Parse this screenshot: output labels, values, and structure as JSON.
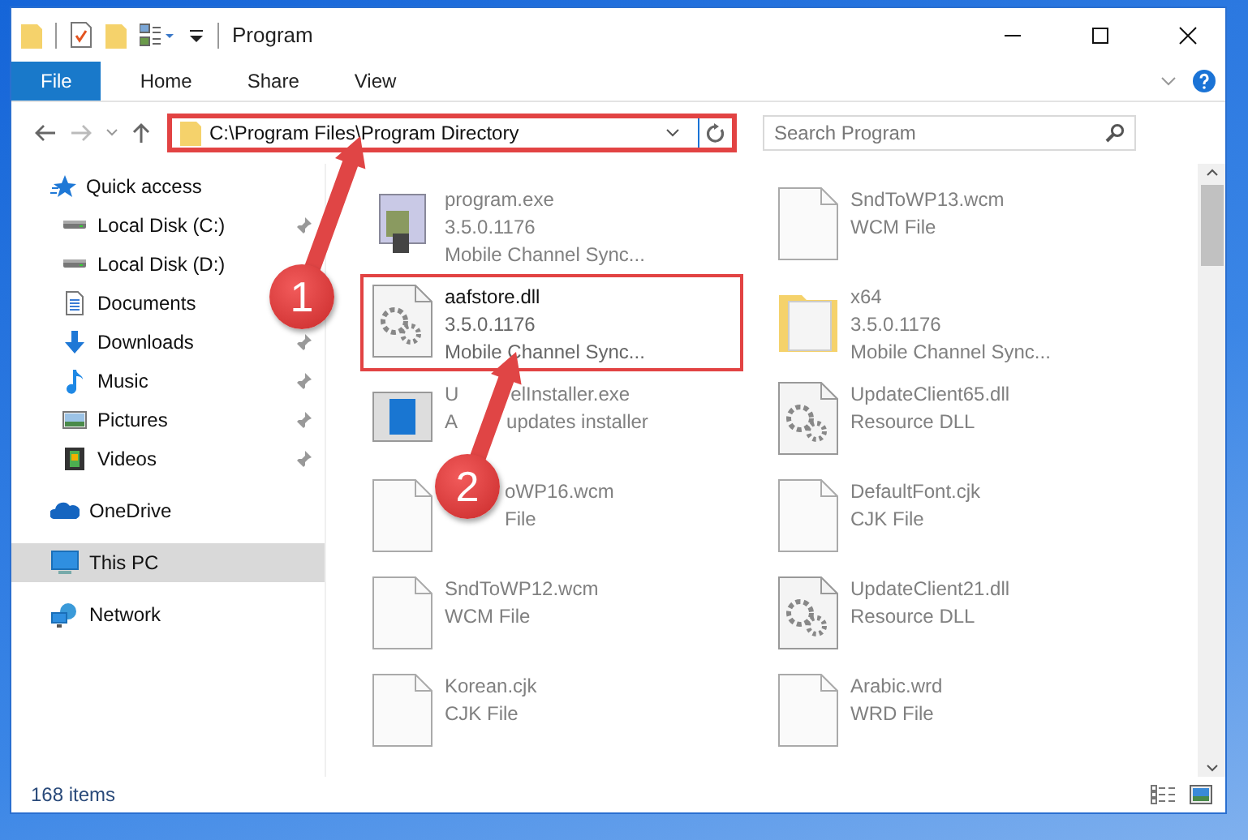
{
  "window": {
    "title": "Program"
  },
  "ribbon_tabs": [
    {
      "label": "File",
      "kind": "file"
    },
    {
      "label": "Home",
      "kind": "tab"
    },
    {
      "label": "Share",
      "kind": "tab"
    },
    {
      "label": "View",
      "kind": "tab"
    }
  ],
  "address": {
    "path": "C:\\Program Files\\Program Directory",
    "highlighted": true
  },
  "search": {
    "placeholder": "Search Program"
  },
  "sidebar": {
    "items": [
      {
        "label": "Quick access",
        "kind": "star",
        "pinned": false,
        "selected": false,
        "children": [
          {
            "label": "Local Disk (C:)",
            "kind": "drive",
            "pinned": true,
            "selected": false
          },
          {
            "label": "Local Disk (D:)",
            "kind": "drive",
            "pinned": false,
            "selected": false
          },
          {
            "label": "Documents",
            "kind": "document",
            "pinned": false,
            "selected": false
          },
          {
            "label": "Downloads",
            "kind": "download",
            "pinned": true,
            "selected": false
          },
          {
            "label": "Music",
            "kind": "music",
            "pinned": true,
            "selected": false
          },
          {
            "label": "Pictures",
            "kind": "pictures",
            "pinned": true,
            "selected": false
          },
          {
            "label": "Videos",
            "kind": "videos",
            "pinned": true,
            "selected": false
          }
        ]
      },
      {
        "label": "OneDrive",
        "kind": "cloud",
        "pinned": false,
        "selected": false
      },
      {
        "label": "This PC",
        "kind": "pc",
        "pinned": false,
        "selected": true
      },
      {
        "label": "Network",
        "kind": "network",
        "pinned": false,
        "selected": false
      }
    ]
  },
  "files": [
    {
      "name": "program.exe",
      "details": [
        "3.5.0.1176",
        "Mobile Channel Sync..."
      ],
      "kind": "exe",
      "highlighted": false
    },
    {
      "name": "SndToWP13.wcm",
      "details": [
        "WCM File"
      ],
      "kind": "blank",
      "highlighted": false
    },
    {
      "name": "aafstore.dll",
      "details": [
        "3.5.0.1176",
        "Mobile Channel Sync..."
      ],
      "kind": "gears",
      "highlighted": true
    },
    {
      "name": "x64",
      "details": [
        "3.5.0.1176",
        "Mobile Channel Sync..."
      ],
      "kind": "folder",
      "highlighted": false
    },
    {
      "name_parts": [
        "U",
        "elInstaller.exe"
      ],
      "detail_parts": [
        [
          "A",
          "updates installer"
        ]
      ],
      "kind": "installer",
      "highlighted": false,
      "covered": true
    },
    {
      "name": "UpdateClient65.dll",
      "details": [
        "Resource DLL"
      ],
      "kind": "gears",
      "highlighted": false
    },
    {
      "name": "oWP16.wcm",
      "details": [
        "File"
      ],
      "kind": "blank",
      "highlighted": false,
      "covered": true
    },
    {
      "name": "DefaultFont.cjk",
      "details": [
        "CJK File"
      ],
      "kind": "blank",
      "highlighted": false
    },
    {
      "name": "SndToWP12.wcm",
      "details": [
        "WCM File"
      ],
      "kind": "blank",
      "highlighted": false
    },
    {
      "name": "UpdateClient21.dll",
      "details": [
        "Resource DLL"
      ],
      "kind": "gears",
      "highlighted": false
    },
    {
      "name": "Korean.cjk",
      "details": [
        "CJK File"
      ],
      "kind": "blank",
      "highlighted": false
    },
    {
      "name": "Arabic.wrd",
      "details": [
        "WRD File"
      ],
      "kind": "blank",
      "highlighted": false
    }
  ],
  "status_bar": {
    "count": "168 items"
  },
  "annotations": [
    {
      "label": "1"
    },
    {
      "label": "2"
    }
  ]
}
